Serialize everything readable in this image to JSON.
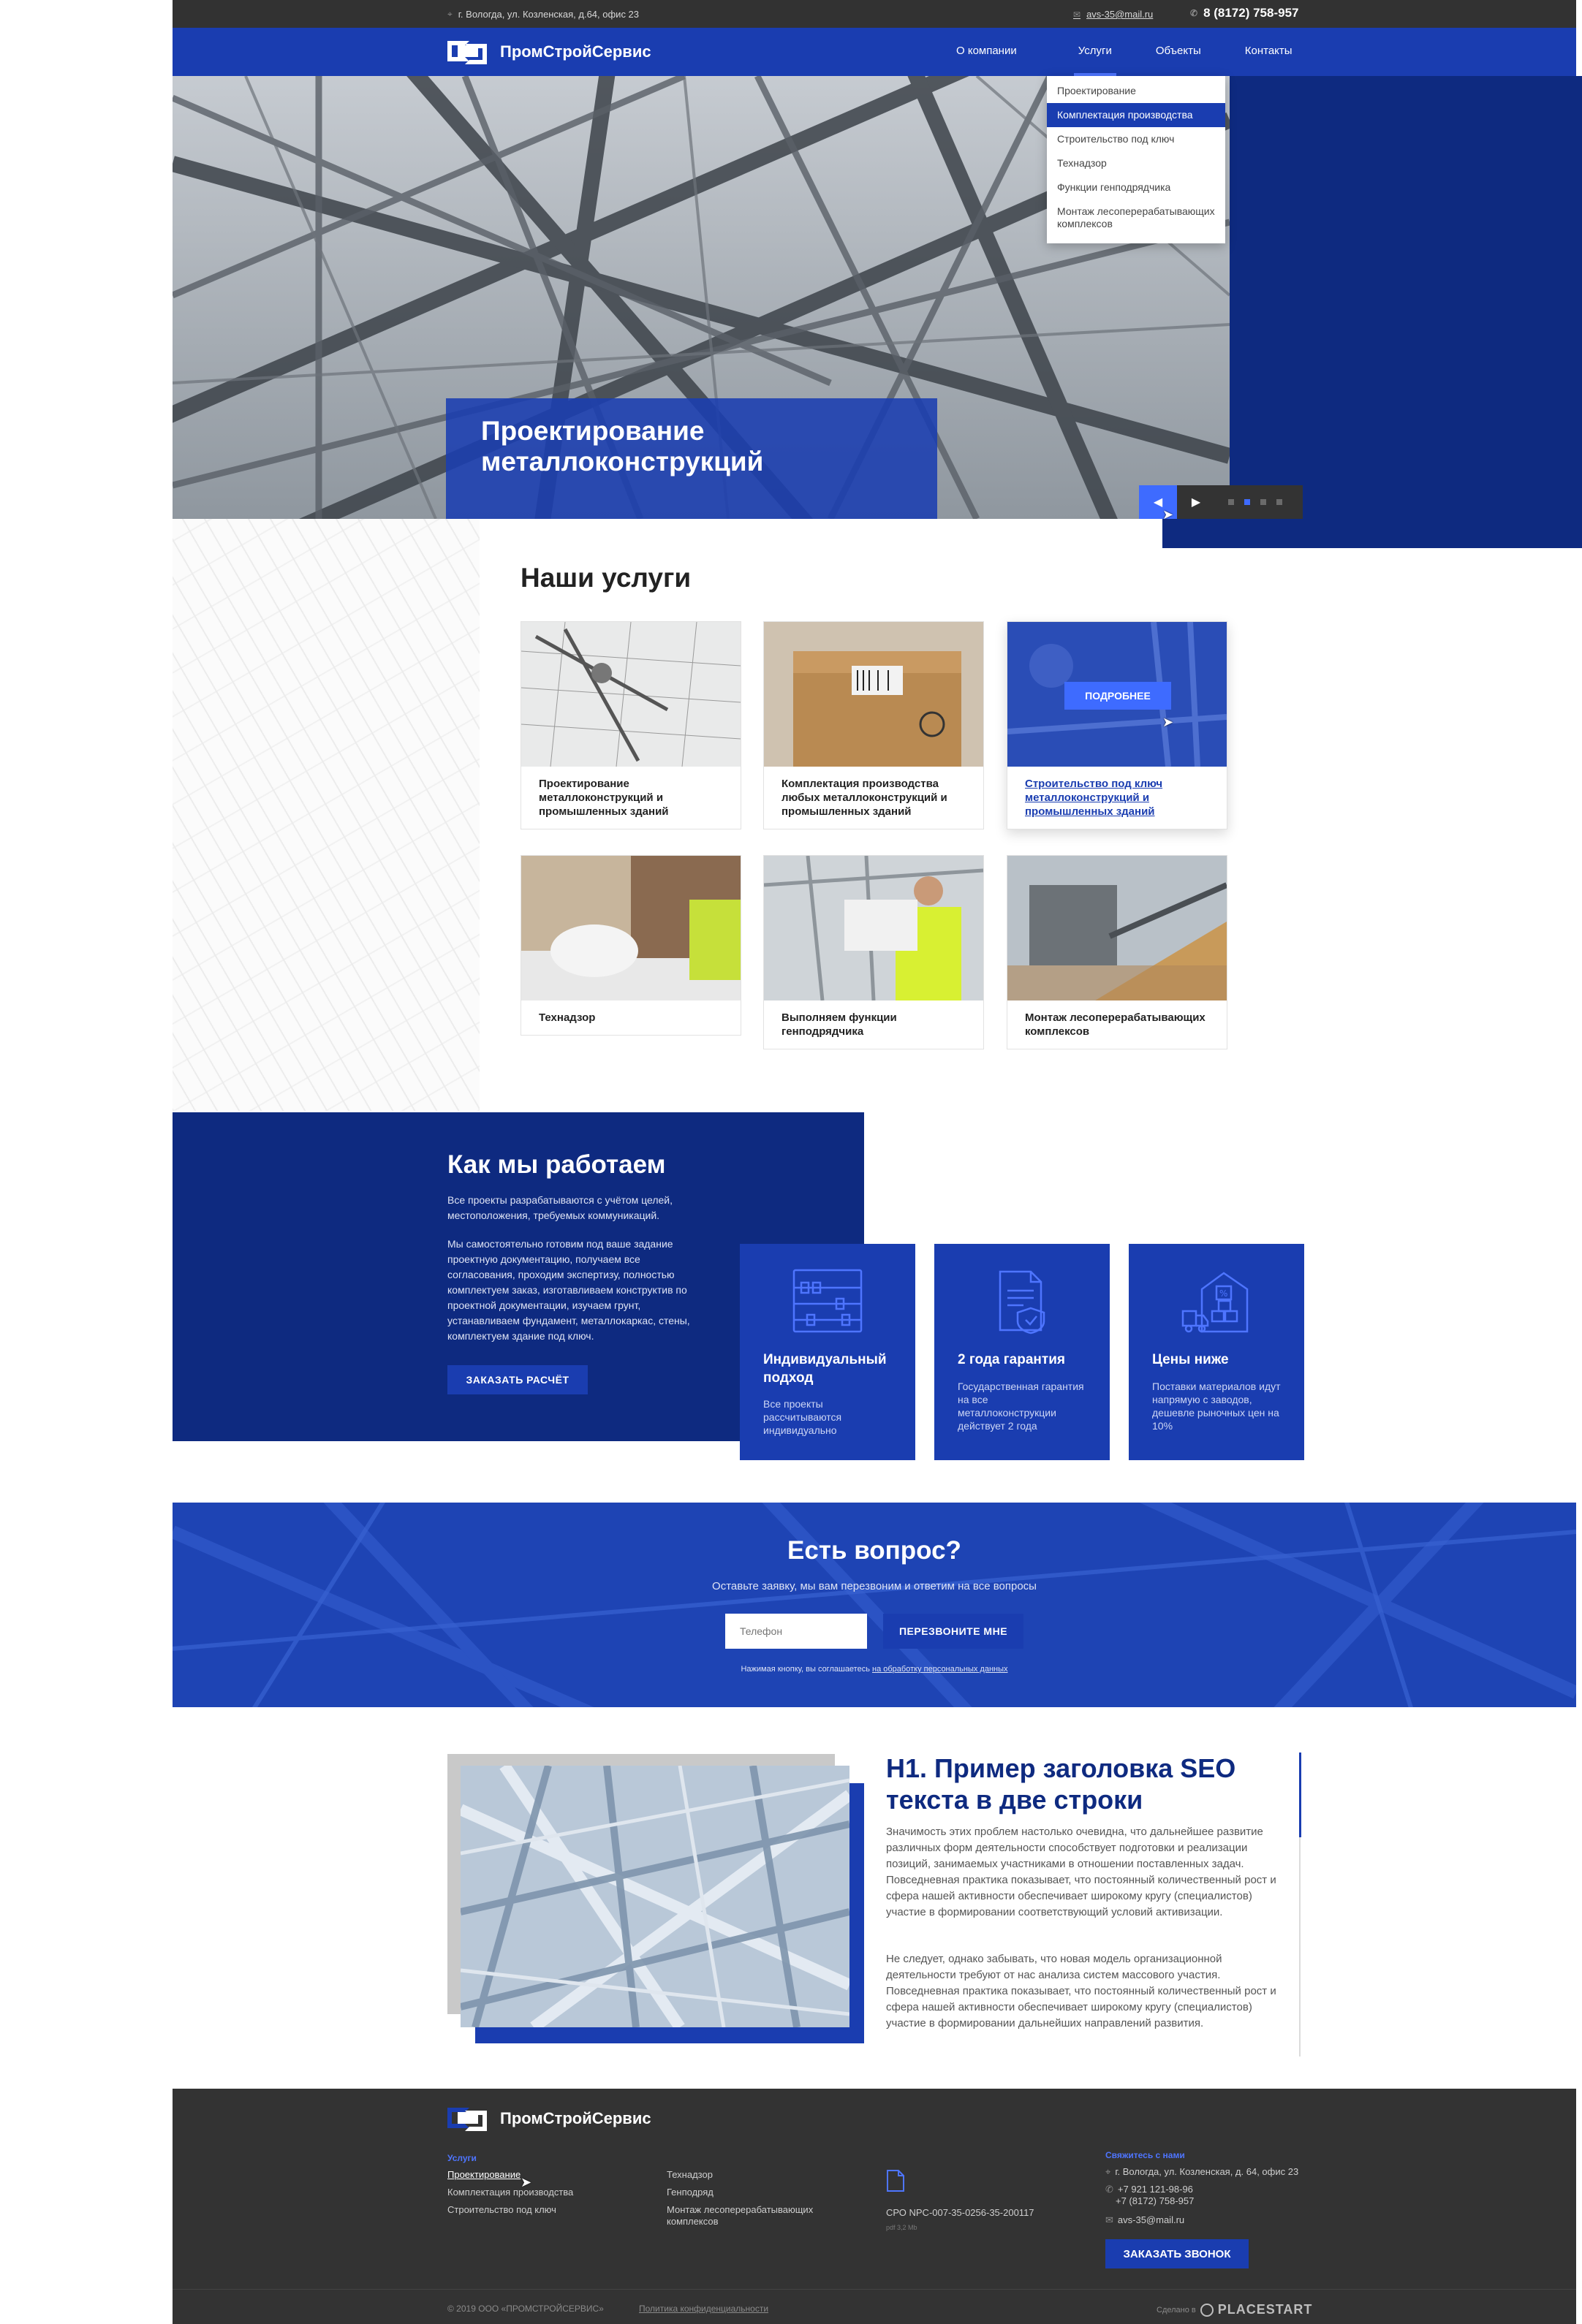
{
  "topbar": {
    "address": "г. Вологда, ул. Козленская, д.64, офис 23",
    "email": "avs-35@mail.ru",
    "phone": "8 (8172) 758-957"
  },
  "brand": {
    "name": "ПромСтройСервис"
  },
  "nav": {
    "items": [
      {
        "label": "О компании"
      },
      {
        "label": "Услуги"
      },
      {
        "label": "Объекты"
      },
      {
        "label": "Контакты"
      }
    ],
    "active": "Услуги"
  },
  "dropdown": {
    "items": [
      {
        "label": "Проектирование"
      },
      {
        "label": "Комплектация производства"
      },
      {
        "label": "Строительство под ключ"
      },
      {
        "label": "Технадзор"
      },
      {
        "label": "Функции генподрядчика"
      },
      {
        "label": "Монтаж лесоперерабатывающих комплексов"
      }
    ],
    "highlighted": "Комплектация производства"
  },
  "hero": {
    "title": "Проектирование металлоконструкций",
    "slides_total": 4,
    "active_slide": 2
  },
  "services": {
    "title": "Наши услуги",
    "more_label": "ПОДРОБНЕЕ",
    "cards": [
      {
        "title": "Проектирование металлоконструкций и промышленных зданий"
      },
      {
        "title": "Комплектация производства любых металлоконструкций и промышленных зданий"
      },
      {
        "title": "Строительство под ключ металлоконструкций и промышленных зданий"
      },
      {
        "title": "Технадзор"
      },
      {
        "title": "Выполняем функции генподрядчика"
      },
      {
        "title": "Монтаж лесоперерабатывающих комплексов"
      }
    ]
  },
  "how": {
    "title": "Как мы работаем",
    "p1": "Все проекты разрабатываются с учётом целей, местоположения, требуемых коммуникаций.",
    "p2": "Мы самостоятельно готовим под ваше задание проектную документацию, получаем все согласования, проходим экспертизу, полностью комплектуем заказ, изготавливаем конструктив по проектной документации, изучаем грунт, устанавливаем фундамент, металлокаркас, стены, комплектуем здание под ключ.",
    "button": "ЗАКАЗАТЬ РАСЧЁТ",
    "features": [
      {
        "title": "Индивидуальный подход",
        "text": "Все проекты рассчитываются индивидуально",
        "icon": "abacus-icon"
      },
      {
        "title": "2 года гарантия",
        "text": "Государственная гарантия на все металлоконструкции действует 2 года",
        "icon": "document-shield-icon"
      },
      {
        "title": "Цены ниже",
        "text": "Поставки материалов идут напрямую с заводов, дешевле рыночных цен на 10%",
        "icon": "warehouse-truck-icon"
      }
    ]
  },
  "ask": {
    "title": "Есть вопрос?",
    "subtitle": "Оставьте заявку, мы вам перезвоним и ответим на все вопросы",
    "phone_placeholder": "Телефон",
    "button": "ПЕРЕЗВОНИТЕ МНЕ",
    "note_prefix": "Нажимая кнопку, вы соглашаетесь",
    "note_link": "на обработку персональных данных"
  },
  "seo": {
    "title": "H1. Пример заголовка SEO текста в две строки",
    "p1": "Значимость этих проблем настолько очевидна, что дальнейшее развитие различных форм деятельности способствует подготовки и реализации позиций, занимаемых участниками в отношении поставленных задач. Повседневная практика показывает, что постоянный количественный рост и сфера нашей активности обеспечивает широкому кругу (специалистов) участие в формировании соответствующий условий активизации.",
    "p2": "Не следует, однако забывать, что новая модель организационной деятельности требуют от нас анализа систем массового участия. Повседневная практика показывает, что постоянный количественный рост и сфера нашей активности обеспечивает широкому кругу (специалистов) участие в формировании дальнейших направлений развития."
  },
  "footer": {
    "services_heading": "Услуги",
    "col1": [
      "Проектирование",
      "Комплектация производства",
      "Строительство под ключ"
    ],
    "col2": [
      "Технадзор",
      "Генподряд",
      "Монтаж лесоперерабатывающих комплексов"
    ],
    "sro": "СРО  NPC-007-35-0256-35-200117",
    "sro_file": "pdf 3,2 Mb",
    "contacts_heading": "Свяжитесь с нами",
    "address": "г. Вологда, ул. Козленская, д. 64, офис 23",
    "phone1": "+7 921 121-98-96",
    "phone2": "+7 (8172) 758-957",
    "email": "avs-35@mail.ru",
    "button": "ЗАКАЗАТЬ ЗВОНОК",
    "copyright": "© 2019 ООО «ПРОМСТРОЙСЕРВИС»",
    "privacy": "Политика конфиденциальности",
    "made_by_label": "Сделано в",
    "made_by": "PLACESTART"
  }
}
